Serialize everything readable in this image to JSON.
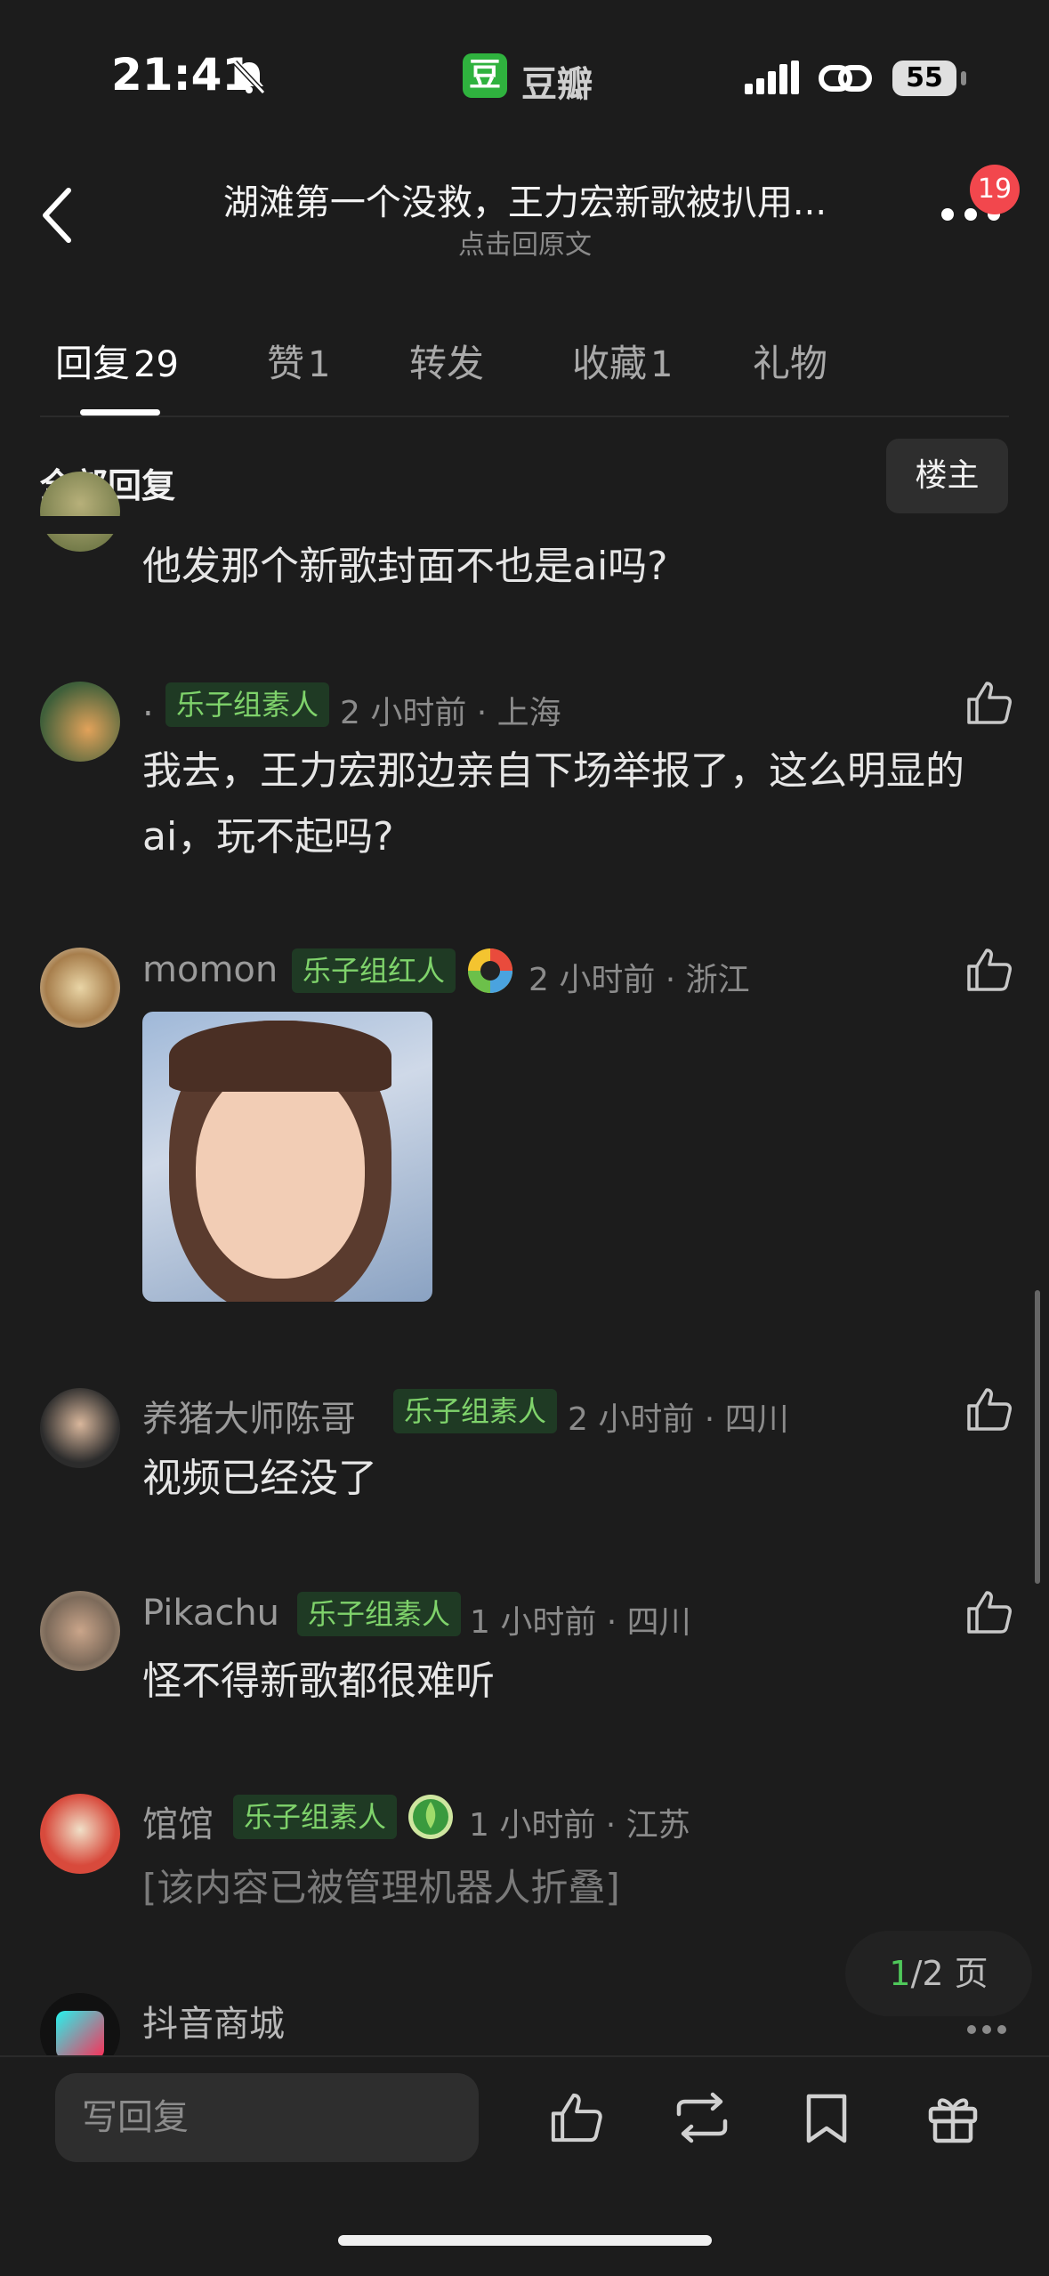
{
  "status_bar": {
    "time": "21:41",
    "app_badge": "豆",
    "app_name": "豆瓣",
    "battery": "55"
  },
  "header": {
    "title": "湖滩第一个没救，王力宏新歌被扒用...",
    "subtitle": "点击回原文",
    "notification_count": "19"
  },
  "tabs": [
    {
      "label": "回复",
      "count": "29"
    },
    {
      "label": "赞",
      "count": "1"
    },
    {
      "label": "转发",
      "count": ""
    },
    {
      "label": "收藏",
      "count": "1"
    },
    {
      "label": "礼物",
      "count": ""
    }
  ],
  "section": {
    "all_replies": "全部回复",
    "op_button": "楼主"
  },
  "comments": [
    {
      "body": "他发那个新歌封面不也是ai吗?"
    },
    {
      "name": ".",
      "tag": "乐子组素人",
      "meta": "2 小时前 · 上海",
      "body": "我去，王力宏那边亲自下场举报了，这么明显的ai，玩不起吗?"
    },
    {
      "name": "momon",
      "tag": "乐子组红人",
      "meta": "2 小时前 · 浙江",
      "body": ""
    },
    {
      "name": "养猪大师陈哥",
      "tag": "乐子组素人",
      "meta": "2 小时前 · 四川",
      "body": "视频已经没了"
    },
    {
      "name": "Pikachu",
      "tag": "乐子组素人",
      "meta": "1 小时前 · 四川",
      "body": "怪不得新歌都很难听"
    },
    {
      "name": "馆馆",
      "tag": "乐子组素人",
      "meta": "1 小时前 · 江苏",
      "body": "[该内容已被管理机器人折叠]"
    },
    {
      "name": "抖音商城"
    }
  ],
  "pager": {
    "current": "1",
    "total": "/2 页"
  },
  "bottom_bar": {
    "reply_placeholder": "写回复"
  },
  "colors": {
    "background": "#1c1c1c",
    "tag_green": "#7fd36b",
    "badge_red": "#f2474d",
    "douban_green": "#2fb23e"
  }
}
